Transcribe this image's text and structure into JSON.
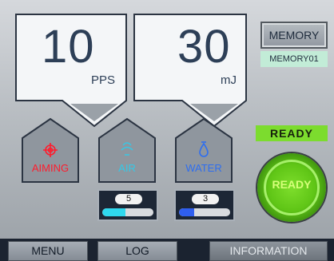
{
  "pulse_rate": {
    "value": "10",
    "unit": "PPS"
  },
  "energy": {
    "value": "30",
    "unit": "mJ"
  },
  "memory": {
    "button_label": "MEMORY",
    "current": "MEMORY01"
  },
  "status": {
    "badge": "READY",
    "button_label": "READY"
  },
  "modes": {
    "aiming": {
      "label": "AIMING",
      "icon": "crosshair-icon",
      "color": "#ff1c2d"
    },
    "air": {
      "label": "AIR",
      "icon": "air-icon",
      "color": "#35c8e6"
    },
    "water": {
      "label": "WATER",
      "icon": "water-drop-icon",
      "color": "#2e6ef0"
    }
  },
  "levels": {
    "air": {
      "value": "5",
      "fill_fraction": 0.45,
      "color": "#2fd9ef"
    },
    "water": {
      "value": "3",
      "fill_fraction": 0.3,
      "color": "#2f5ff0"
    }
  },
  "nav": {
    "menu": "MENU",
    "log": "LOG",
    "information": "INFORMATION"
  }
}
